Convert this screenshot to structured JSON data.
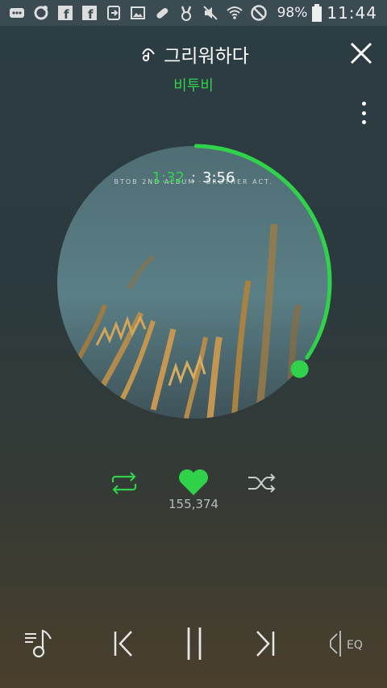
{
  "status_bar": {
    "icons": [
      "message-icon",
      "record-icon",
      "facebook-icon",
      "facebook-icon",
      "cast-icon",
      "image-icon",
      "pill-icon",
      "victory-hand-icon",
      "mute-icon",
      "wifi-icon",
      "do-not-disturb-icon"
    ],
    "battery": "98%",
    "time": "11:44"
  },
  "header": {
    "title": "그리워하다",
    "artist": "비투비"
  },
  "album": {
    "cover_text": "BTOB 2ND ALBUM · BROTHER ACT.",
    "progress_fraction": 0.34
  },
  "time": {
    "current": "1:32",
    "separator": ":",
    "total": "3:56"
  },
  "actions": {
    "like_count": "155,374"
  },
  "colors": {
    "accent": "#2fd24a"
  }
}
